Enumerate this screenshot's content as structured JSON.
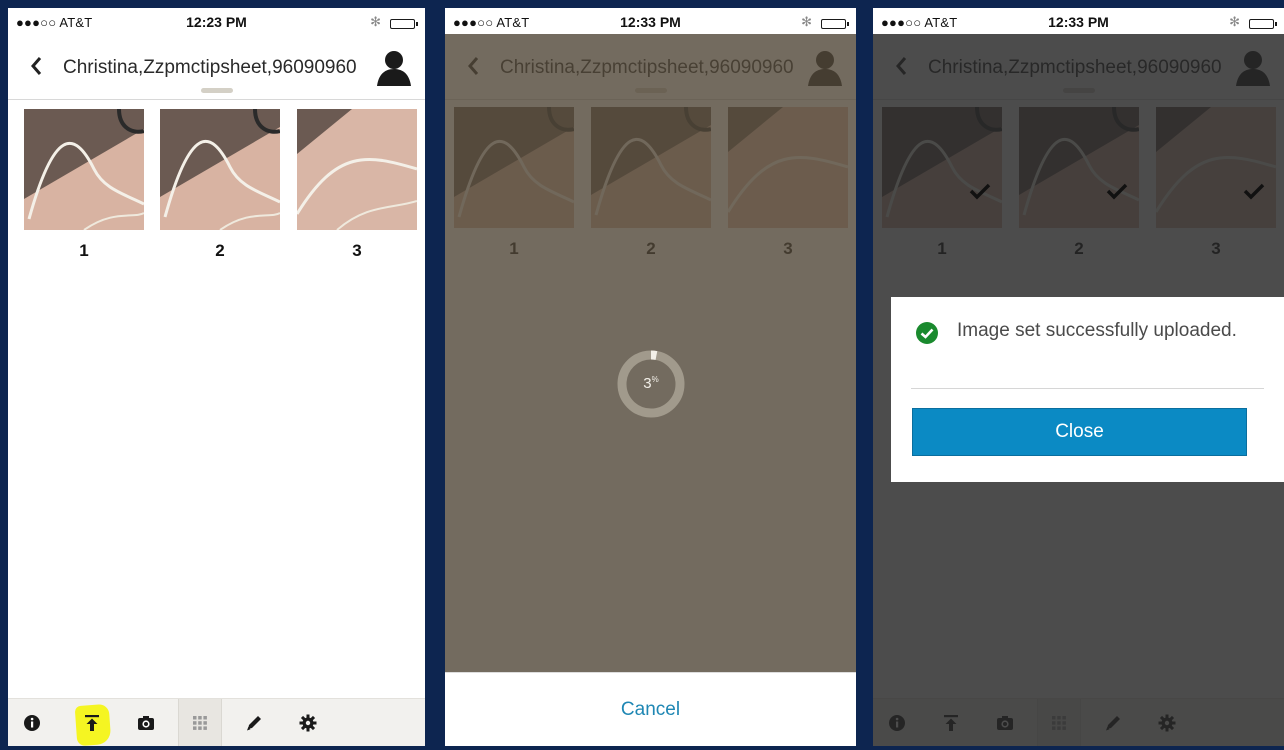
{
  "status": {
    "carrier": "●●●○○ AT&T",
    "bluetooth": "✻"
  },
  "panels": [
    {
      "time": "12:23 PM"
    },
    {
      "time": "12:33 PM"
    },
    {
      "time": "12:33 PM"
    }
  ],
  "header": {
    "title": "Christina,Zzpmctipsheet,96090960"
  },
  "thumbnails": [
    {
      "label": "1"
    },
    {
      "label": "2"
    },
    {
      "label": "3"
    }
  ],
  "toolbar": {
    "items": [
      "info-icon",
      "upload-icon",
      "camera-icon",
      "grid-icon",
      "pencil-icon",
      "gear-icon"
    ],
    "highlighted": "upload-icon"
  },
  "upload": {
    "progress_value": "3",
    "progress_unit": "%",
    "progress_fraction": 0.03,
    "cancel_label": "Cancel"
  },
  "dialog": {
    "message": "Image set successfully uploaded.",
    "close_label": "Close"
  },
  "colors": {
    "accent": "#0b8ac4",
    "success": "#1a8a2e",
    "highlight": "#f5f522",
    "link": "#1f87b4"
  }
}
